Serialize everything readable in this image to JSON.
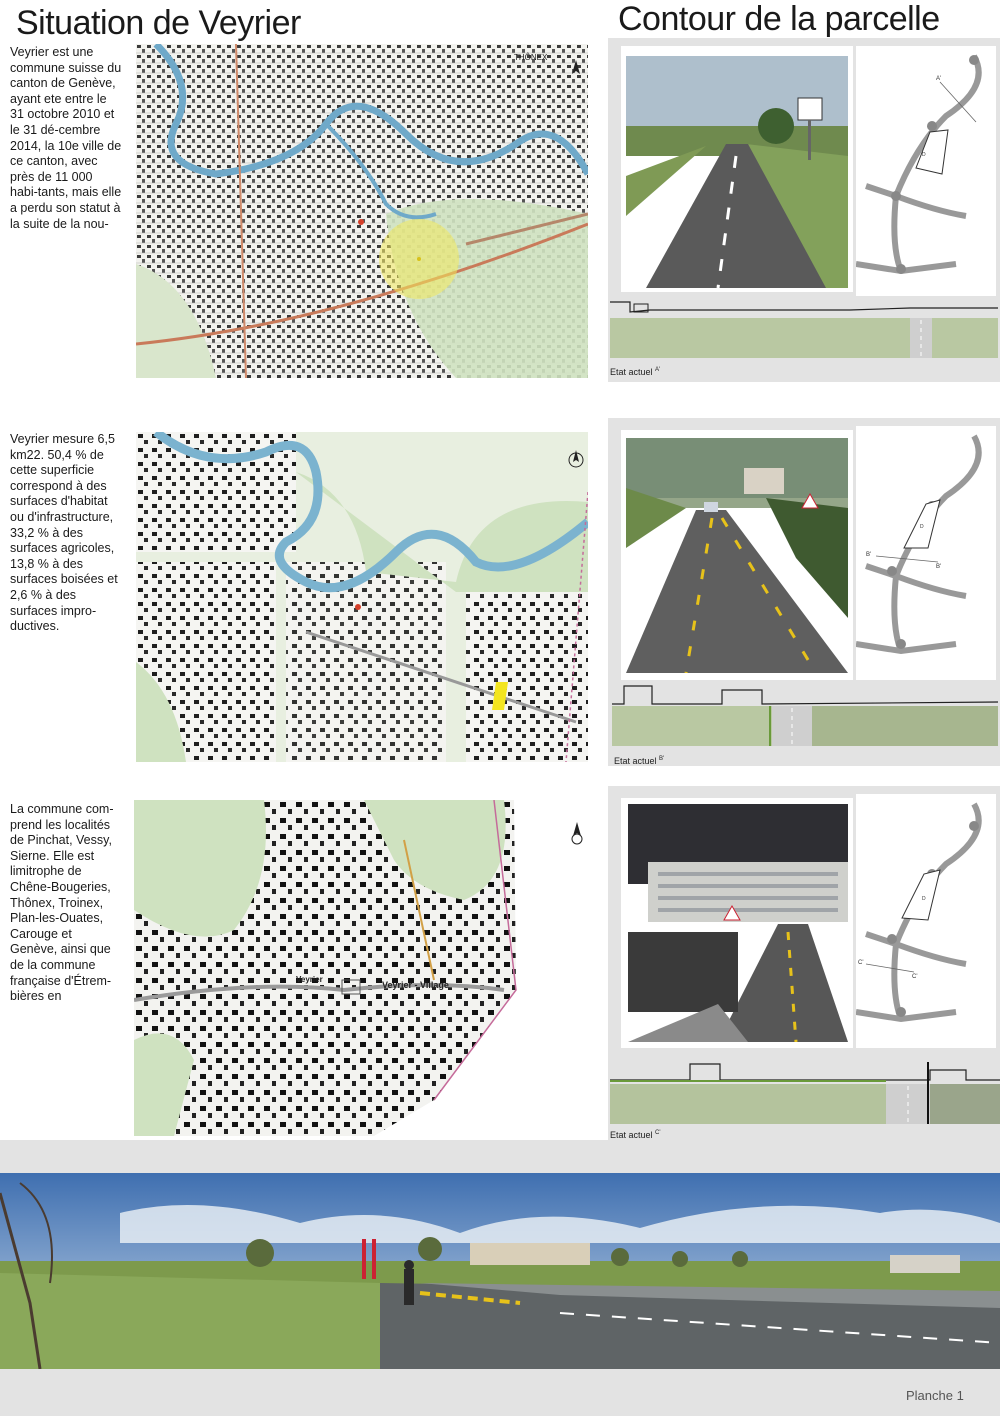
{
  "left": {
    "title": "Situation de Veyrier",
    "paragraphs": [
      "Veyrier est une commune suisse du canton de Genève, ayant ete entre le 31 octobre 2010 et le 31 dé-cembre 2014, la 10e ville de ce canton, avec près de 11 000 habi-tants, mais elle a perdu son statut à la suite de la nou-",
      "Veyrier mesure 6,5 km22. 50,4 % de cette superficie correspond à des surfaces d'habitat ou d'infrastructure, 33,2 % à des surfaces agricoles, 13,8 % à des surfaces boisées et 2,6 % à des surfaces impro-ductives.",
      "La commune com-prend les localités de Pinchat, Vessy, Sierne. Elle est limitrophe de Chêne-Bougeries, Thônex, Troinex, Plan-les-Ouates, Carouge et Genève, ainsi que de la commune française d'Étrem-bières en"
    ],
    "map_labels": {
      "map1_north": "THÔNEX",
      "map3_village": "Veyrier - Village",
      "map3_town": "Veyrier"
    }
  },
  "right": {
    "title": "Contour de la parcelle",
    "sections": [
      {
        "caption": "Etat actuel",
        "suffix": "A'",
        "cut_a": "A'",
        "cut_b": "A",
        "parcel": "D"
      },
      {
        "caption": "Etat actuel",
        "suffix": "B'",
        "cut_a": "B'",
        "cut_b": "B'",
        "parcel": "D"
      },
      {
        "caption": "Etat actuel",
        "suffix": "C'",
        "cut_a": "C'",
        "cut_b": "C'",
        "parcel": "D"
      }
    ]
  },
  "footer": {
    "label": "Planche 1"
  },
  "colors": {
    "panel_grey": "#e3e3e3",
    "map_green": "#cfe2c0",
    "river": "#6fa9c9",
    "highlight_yellow": "#f3ea5c"
  }
}
